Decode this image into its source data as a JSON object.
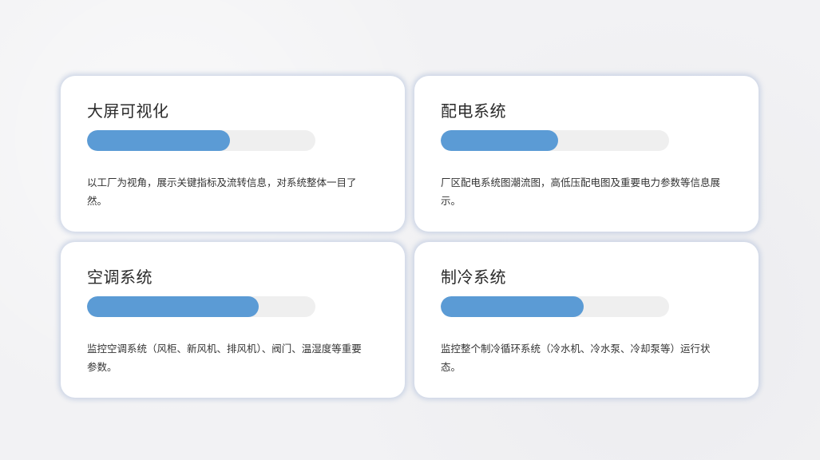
{
  "cards": [
    {
      "title": "大屏可视化",
      "progress": 0.625,
      "description": "以工厂为视角，展示关键指标及流转信息，对系统整体一目了然。"
    },
    {
      "title": "配电系统",
      "progress": 0.515,
      "description": "厂区配电系统图潮流图，高低压配电图及重要电力参数等信息展示。"
    },
    {
      "title": "空调系统",
      "progress": 0.75,
      "description": "监控空调系统（风柜、新风机、排风机）、阀门、温湿度等重要参数。"
    },
    {
      "title": "制冷系统",
      "progress": 0.625,
      "description": "监控整个制冷循环系统（冷水机、冷水泵、冷却泵等）运行状态。"
    }
  ],
  "colors": {
    "accent": "#5b9bd5",
    "track": "#efefef",
    "card": "#ffffff",
    "background": "#f2f2f4"
  }
}
